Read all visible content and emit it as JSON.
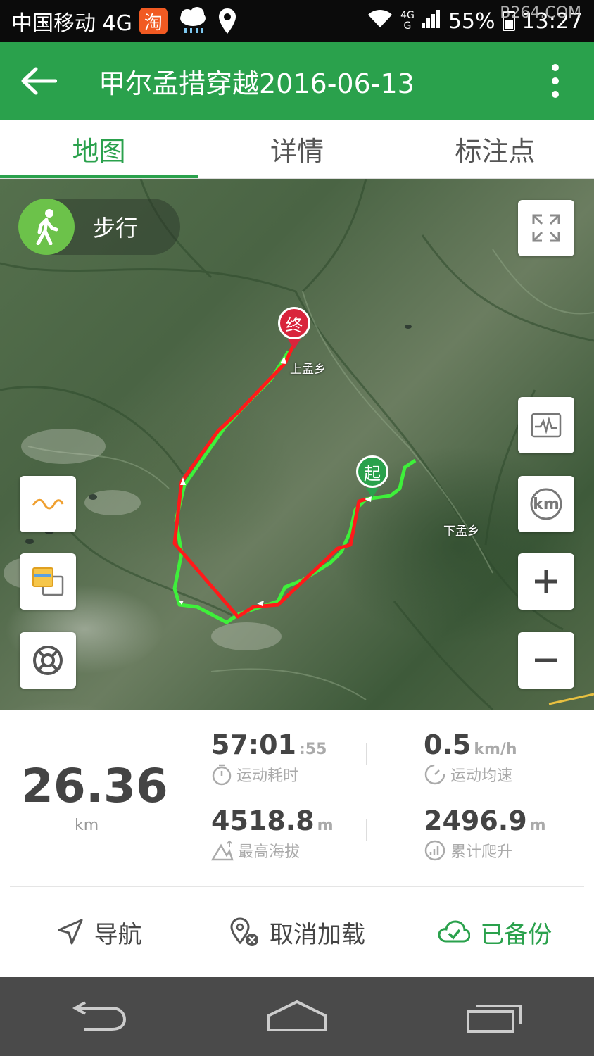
{
  "status_bar": {
    "carrier": "中国移动 4G",
    "tao_icon_text": "淘",
    "network_top": "4G",
    "network_bottom": "G",
    "battery": "55%",
    "time": "13:27",
    "watermark": "B264.COM"
  },
  "app_bar": {
    "title": "甲尔孟措穿越2016-06-13"
  },
  "tabs": [
    {
      "label": "地图",
      "active": true
    },
    {
      "label": "详情",
      "active": false
    },
    {
      "label": "标注点",
      "active": false
    }
  ],
  "map": {
    "mode_label": "步行",
    "end_marker": "终",
    "start_marker": "起",
    "places": {
      "upper_town": "上孟乡",
      "lower_town": "下孟乡"
    },
    "km_button": "km"
  },
  "stats": {
    "distance": "26.36",
    "distance_unit": "km",
    "duration_main": "57:01",
    "duration_sec": ":55",
    "duration_label": "运动耗时",
    "avg_speed": "0.5",
    "avg_speed_unit": "km/h",
    "avg_speed_label": "运动均速",
    "max_altitude": "4518.8",
    "max_altitude_unit": "m",
    "max_altitude_label": "最高海拔",
    "climb": "2496.9",
    "climb_unit": "m",
    "climb_label": "累计爬升"
  },
  "actions": {
    "navigate": "导航",
    "unload": "取消加载",
    "backed_up": "已备份"
  },
  "colors": {
    "primary_green": "#2aa14c",
    "track_red": "#ff1a1a",
    "track_green": "#3ef03a",
    "end_pin": "#d9243c"
  }
}
